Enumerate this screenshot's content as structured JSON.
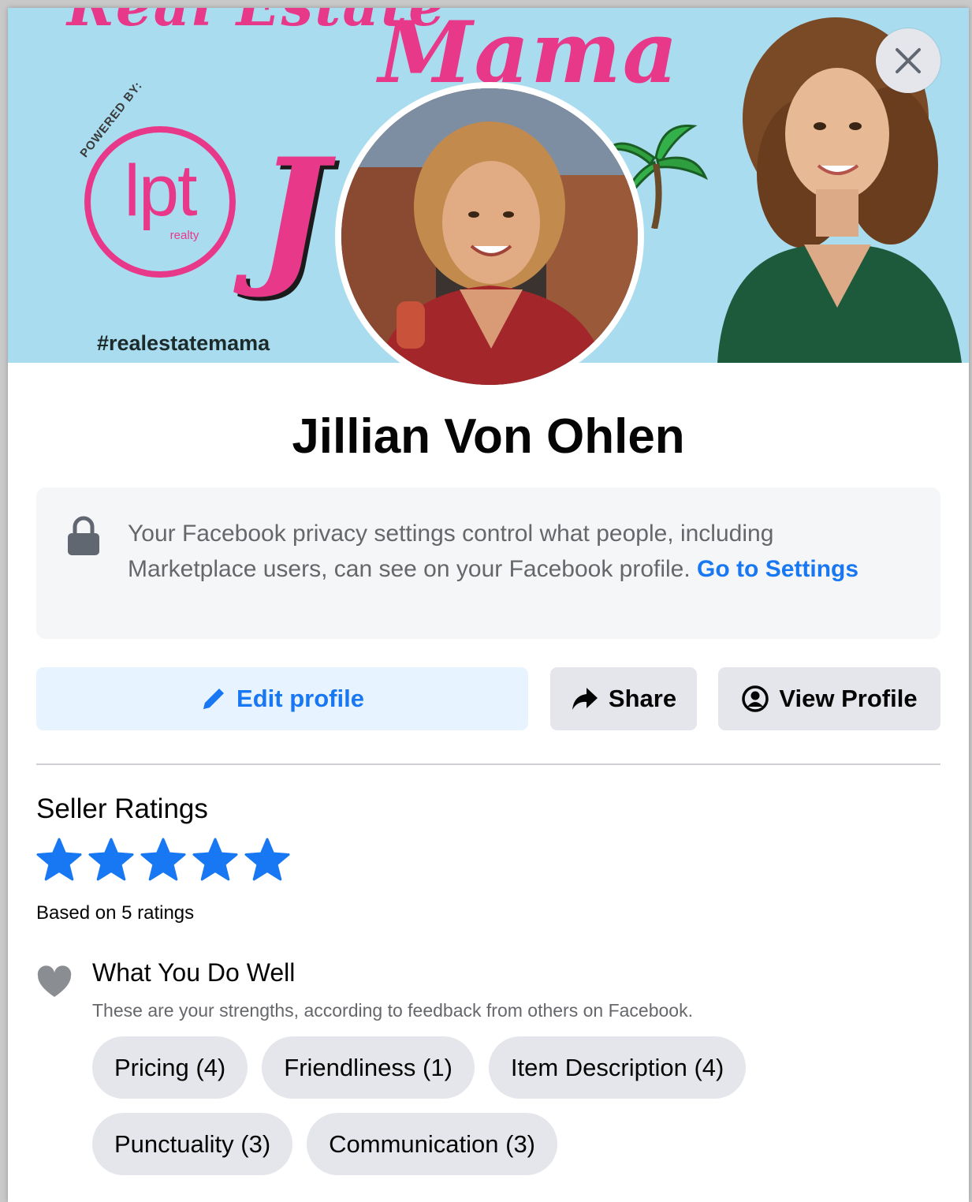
{
  "cover": {
    "brand_line1": "Real Estate",
    "brand_line2": "Mama",
    "powered_by": "POWERED BY:",
    "logo_text": "lpt",
    "logo_sub": "realty",
    "initial": "J",
    "hashtag": "#realestatemama"
  },
  "profile": {
    "name": "Jillian Von Ohlen"
  },
  "privacy": {
    "text": "Your Facebook privacy settings control what people, including Marketplace users, can see on your Facebook profile. ",
    "link_label": "Go to Settings"
  },
  "actions": {
    "edit_label": "Edit profile",
    "share_label": "Share",
    "view_label": "View Profile"
  },
  "ratings": {
    "title": "Seller Ratings",
    "stars_filled": 5,
    "stars_total": 5,
    "note": "Based on 5 ratings"
  },
  "strengths": {
    "title": "What You Do Well",
    "subtitle": "These are your strengths, according to feedback from others on Facebook.",
    "chips": [
      "Pricing (4)",
      "Friendliness (1)",
      "Item Description (4)",
      "Punctuality (3)",
      "Communication (3)"
    ]
  },
  "icons": {
    "close": "close-icon",
    "lock": "lock-icon",
    "edit": "pencil-icon",
    "share": "share-arrow-icon",
    "view": "user-circle-icon",
    "star": "star-icon",
    "heart": "heart-icon"
  },
  "colors": {
    "accent": "#1877f2",
    "accent_soft": "#e7f3ff",
    "cover_bg": "#aadcef",
    "brand_pink": "#e8388a",
    "chip_bg": "#e4e6eb",
    "muted_text": "#65676b"
  }
}
